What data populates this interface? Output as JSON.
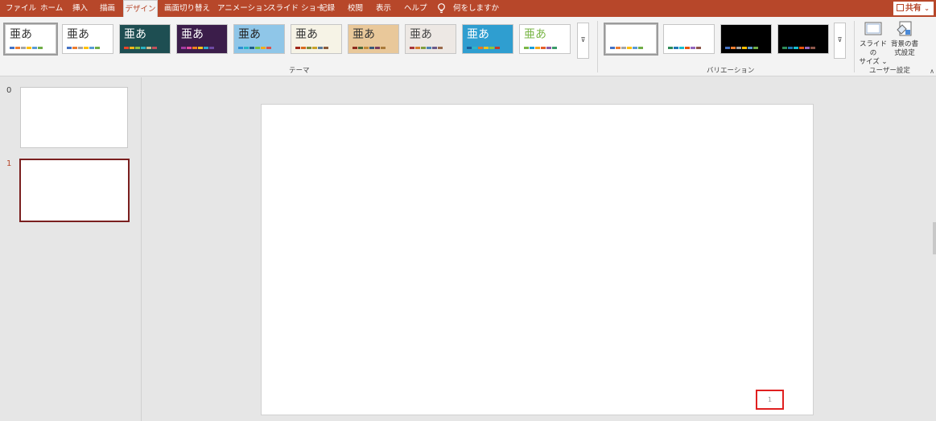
{
  "tabs": [
    {
      "label": "ファイル",
      "active": false
    },
    {
      "label": "ホーム",
      "active": false
    },
    {
      "label": "挿入",
      "active": false
    },
    {
      "label": "描画",
      "active": false
    },
    {
      "label": "デザイン",
      "active": true
    },
    {
      "label": "画面切り替え",
      "active": false
    },
    {
      "label": "アニメーション",
      "active": false
    },
    {
      "label": "スライド ショー",
      "active": false
    },
    {
      "label": "記録",
      "active": false
    },
    {
      "label": "校閲",
      "active": false
    },
    {
      "label": "表示",
      "active": false
    },
    {
      "label": "ヘルプ",
      "active": false
    }
  ],
  "tell_me": {
    "label": "何をしますか",
    "icon": "lightbulb-icon"
  },
  "share": {
    "label": "共有",
    "icon": "share-icon"
  },
  "themes": {
    "group_label": "テーマ",
    "items": [
      {
        "text": "亜あ",
        "bg": "#ffffff",
        "fg": "#333333",
        "selected": true,
        "colors": [
          "#4472c4",
          "#ed7d31",
          "#a5a5a5",
          "#ffc000",
          "#5b9bd5",
          "#70ad47"
        ]
      },
      {
        "text": "亜あ",
        "bg": "#ffffff",
        "fg": "#333333",
        "selected": false,
        "colors": [
          "#4472c4",
          "#ed7d31",
          "#a5a5a5",
          "#ffc000",
          "#5b9bd5",
          "#70ad47"
        ]
      },
      {
        "text": "亜あ",
        "bg": "#1e4e52",
        "fg": "#ffffff",
        "selected": false,
        "colors": [
          "#e8452a",
          "#f4b619",
          "#8fc03f",
          "#2bb3c0",
          "#d0b98a",
          "#c54f5b"
        ]
      },
      {
        "text": "亜あ",
        "bg": "#3b1d4a",
        "fg": "#ffffff",
        "selected": false,
        "colors": [
          "#a53ba3",
          "#e84ba0",
          "#f07f1e",
          "#f3c21a",
          "#2ea8cc",
          "#6e4aa3"
        ]
      },
      {
        "text": "亜あ",
        "bg": "#8fc6e8",
        "fg": "#222222",
        "selected": false,
        "colors": [
          "#2d8fd5",
          "#29b4c4",
          "#1f5f8a",
          "#7ac142",
          "#f0ab1e",
          "#d9534f"
        ]
      },
      {
        "text": "亜あ",
        "bg": "#f6f3e6",
        "fg": "#333333",
        "selected": false,
        "colors": [
          "#a0281a",
          "#d86a1e",
          "#7a8b3a",
          "#c9a227",
          "#5a7a9a",
          "#8a5a3a"
        ]
      },
      {
        "text": "亜あ",
        "bg": "#e9c89a",
        "fg": "#333333",
        "selected": false,
        "colors": [
          "#8e2a1e",
          "#4a6b3a",
          "#c08a3a",
          "#3a5a7a",
          "#7a3a5a",
          "#aa7a3a"
        ]
      },
      {
        "text": "亜あ",
        "bg": "#ede8e4",
        "fg": "#444444",
        "selected": false,
        "colors": [
          "#a8373a",
          "#d57d2c",
          "#829e3e",
          "#4c83b5",
          "#6a5a8a",
          "#9a6a4a"
        ]
      },
      {
        "text": "亜あ",
        "bg": "#2f9ed0",
        "fg": "#ffffff",
        "selected": false,
        "colors": [
          "#1c5d99",
          "#2bb6c6",
          "#e87722",
          "#f2c218",
          "#8dc63f",
          "#c0392b"
        ]
      },
      {
        "text": "亜あ",
        "bg": "#ffffff",
        "fg": "#7ab648",
        "selected": false,
        "colors": [
          "#7ab648",
          "#1d9ed9",
          "#f4a81d",
          "#e35e2b",
          "#8a5ca8",
          "#3a9a6a"
        ]
      }
    ]
  },
  "variations": {
    "group_label": "バリエーション",
    "items": [
      {
        "bg": "#ffffff",
        "selected": true,
        "colors": [
          "#4472c4",
          "#ed7d31",
          "#a5a5a5",
          "#ffc000",
          "#5b9bd5",
          "#70ad47"
        ]
      },
      {
        "bg": "#ffffff",
        "selected": false,
        "colors": [
          "#2e8b57",
          "#1f77b4",
          "#17becf",
          "#e6550d",
          "#9467bd",
          "#8c564b"
        ]
      },
      {
        "bg": "#000000",
        "selected": false,
        "colors": [
          "#4472c4",
          "#ed7d31",
          "#a5a5a5",
          "#ffc000",
          "#5b9bd5",
          "#70ad47"
        ]
      },
      {
        "bg": "#000000",
        "selected": false,
        "colors": [
          "#2e8b57",
          "#1f77b4",
          "#17becf",
          "#e6550d",
          "#9467bd",
          "#8c564b"
        ]
      }
    ]
  },
  "customize": {
    "group_label": "ユーザー設定",
    "slide_size": {
      "line1": "スライドの",
      "line2": "サイズ ⌄",
      "icon": "slide-size-icon"
    },
    "format_bg": {
      "line1": "背景の書",
      "line2": "式設定",
      "icon": "format-background-icon"
    }
  },
  "slides": [
    {
      "number": "0",
      "current": false
    },
    {
      "number": "1",
      "current": true
    }
  ],
  "editor": {
    "page_number": "1"
  },
  "more_glyph": "⊽",
  "collapse_glyph": "∧"
}
